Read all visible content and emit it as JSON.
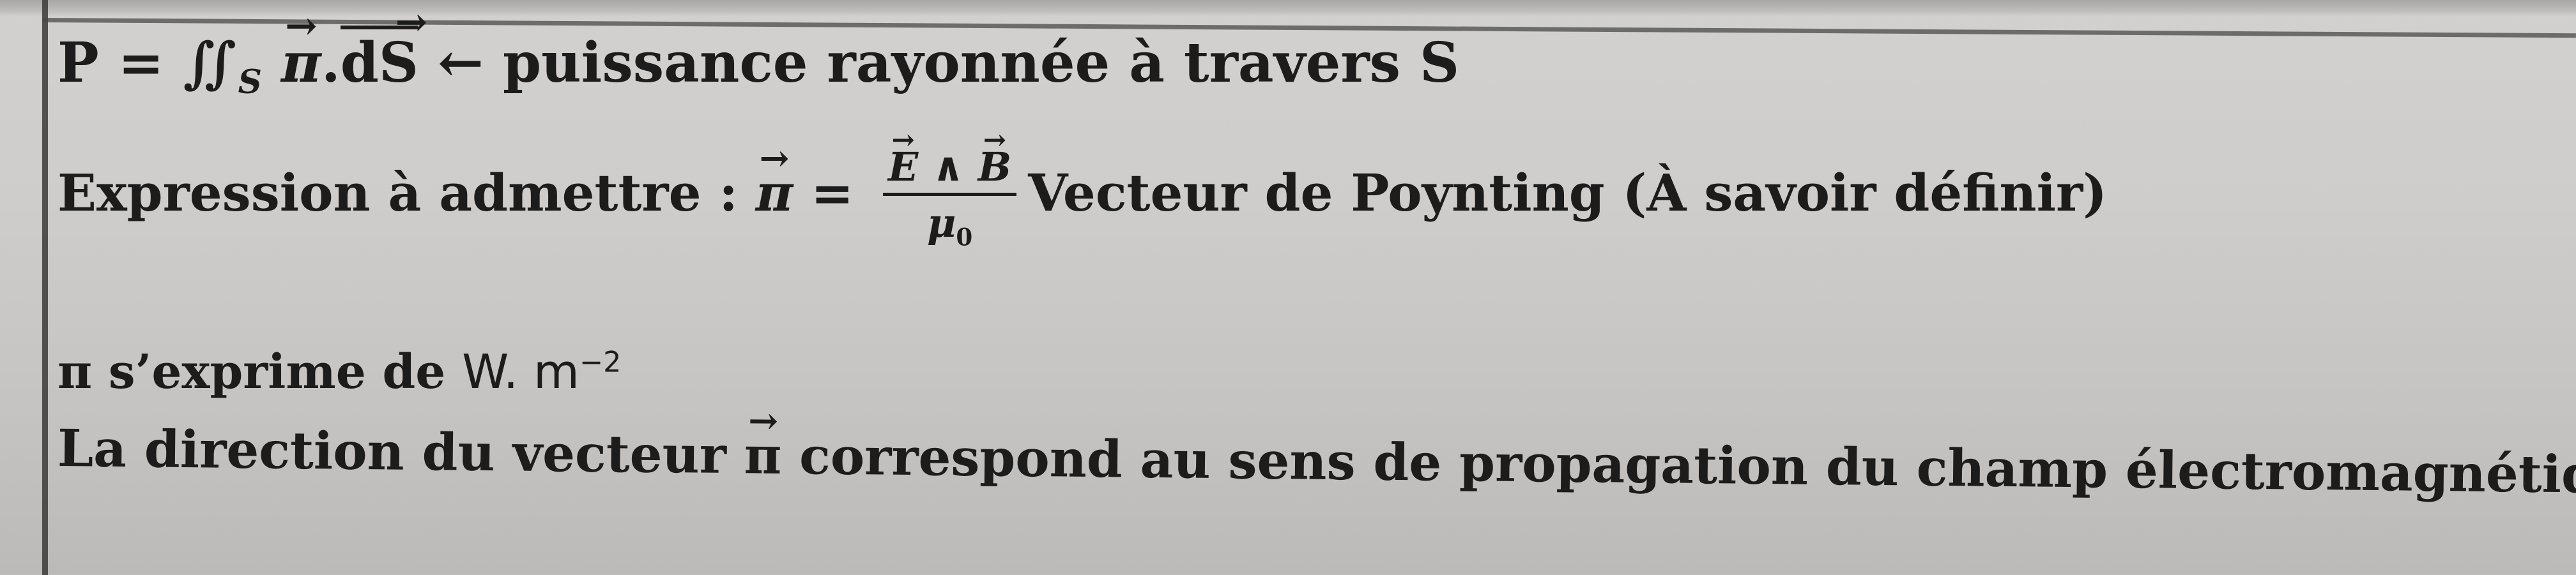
{
  "line1": {
    "formula_lhs": "P = ∬",
    "formula_sub": "S",
    "pi": "π",
    "dot": ".",
    "ds": "dS",
    "arrow": " ← ",
    "text": "puissance rayonnée à travers S"
  },
  "line2": {
    "label": "Expression à admettre : ",
    "pi": "π",
    "equals": " = ",
    "num_e": "E",
    "wedge": " ∧ ",
    "num_b": "B",
    "den_mu": "μ",
    "den_sub": "0",
    "text": "Vecteur de Poynting (À savoir définir)"
  },
  "line3": {
    "text": "π s’exprime de ",
    "unit": "W. m",
    "exponent": "−2"
  },
  "line4": {
    "text_a": "La direction du vecteur ",
    "pi": "π",
    "text_b": " correspond au sens de propagation du champ électromagnétique."
  }
}
